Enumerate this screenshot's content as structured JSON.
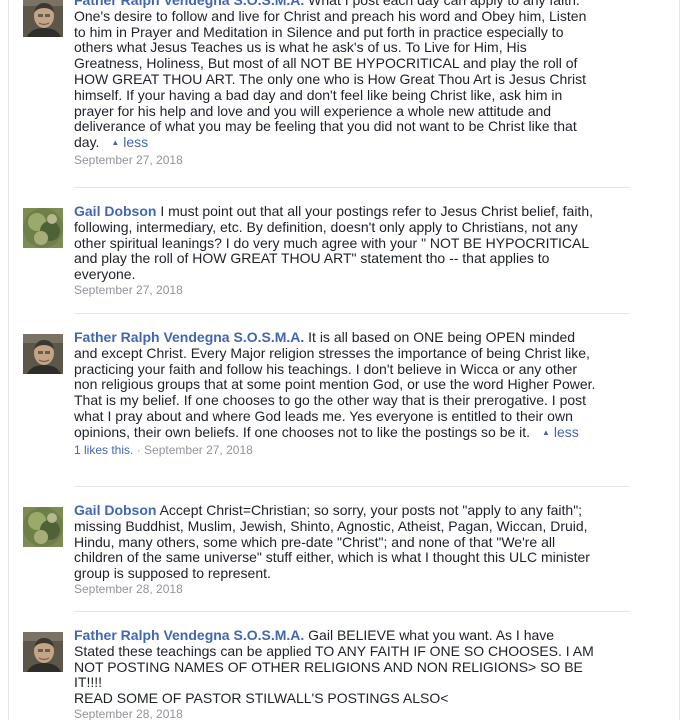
{
  "comments": [
    {
      "author": "Father Ralph Vendegna S.O.S.M.A.",
      "avatar": "man-portrait",
      "text": "What I post each day can apply to any faith. One's desire to follow and live for Christ and preach his word and Obey him, Listen to him in Prayer and Meditation in Silence and put forth in practice especially to others what Jesus Teaches us is what he ask's of us. To Live for Him, His Greatness, Holiness, But most of all NOT BE HYPOCRITICAL and play the roll of HOW GREAT THOU ART. The only one who is How Great Thou Art is Jesus Christ himself. If your having a bad day and don't feel like being Christ like, ask him in prayer for his help and love and you will experience a whole new attitude and deliverance of what you may be feeling that you did not want to be Christ like that day.",
      "less_label": "less",
      "date": "September 27, 2018"
    },
    {
      "author": "Gail Dobson",
      "avatar": "nature-portrait",
      "text": "I must point out that all your postings refer to Jesus Christ belief, faith, following, intermediary, etc. By definition, doesn't only apply to Christians, not any other spiritual leanings? I do very much agree with your \" NOT BE HYPOCRITICAL and play the roll of HOW GREAT THOU ART\" statement tho -- that applies to everyone.",
      "date": "September 27, 2018"
    },
    {
      "author": "Father Ralph Vendegna S.O.S.M.A.",
      "avatar": "man-portrait",
      "text": "It is all based on ONE being OPEN minded and except Christ. Every Major religion stresses the importance of being Christ like, practicing your faith and follow his teachings. I don't believe in Wicca or any other non religious groups that at some point mention God, or use the word Higher Power. That is my belief. If one chooses to go the other way that is their prerogative. I post what I pray about and where God leads me. Yes everyone is entitled to their own opinions, their own beliefs. If one chooses not to like the postings so be it.",
      "less_label": "less",
      "likes": "1 likes this.",
      "separator": "·",
      "date": "September 27, 2018"
    },
    {
      "author": "Gail Dobson",
      "avatar": "nature-portrait",
      "text": "Accept Christ=Christian; so sorry, your posts not \"apply to any faith\"; missing Buddhist, Muslim, Jewish, Shinto, Agnostic, Atheist, Pagan, Wiccan, Druid, Hindu, many others, some which pre-date \"Christ\"; and none of that \"We're all children of the same universe\" stuff either, which is what I thought this ULC minister group is supposed to represent.",
      "date": "September 28, 2018"
    },
    {
      "author": "Father Ralph Vendegna S.O.S.M.A.",
      "avatar": "man-portrait",
      "text": "Gail BELIEVE what you want. As I have Stated these teachings can be applied TO ANY FAITH IF ONE SO CHOOSES. I AM NOT POSTING NAMES OF OTHER RELIGIONS AND NON RELIGIONS> SO BE IT!!!!",
      "text2": "READ SOME OF PASTOR STILWALL'S POSTINGS ALSO<",
      "date": "September 28, 2018"
    }
  ]
}
